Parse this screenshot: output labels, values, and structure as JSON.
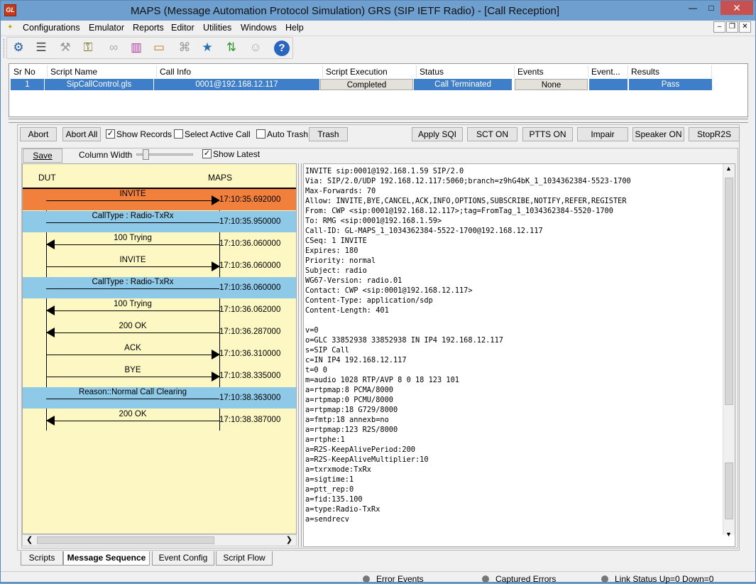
{
  "window": {
    "logo": "GL",
    "title": "MAPS (Message Automation Protocol Simulation) GRS (SIP IETF Radio) - [Call Reception]"
  },
  "menu": {
    "items": [
      "Configurations",
      "Emulator",
      "Reports",
      "Editor",
      "Utilities",
      "Windows",
      "Help"
    ]
  },
  "toolbar": {
    "icons": [
      "gear-icon",
      "book-icon",
      "tools-icon",
      "key-icon",
      "link-icon",
      "database-icon",
      "folder-icon",
      "scope-icon",
      "wizard-icon",
      "refresh-icon",
      "user-icon",
      "help-icon"
    ]
  },
  "grid": {
    "headers": [
      "Sr No",
      "Script Name",
      "Call Info",
      "Script Execution",
      "Status",
      "Events",
      "Event...",
      "Results"
    ],
    "row": [
      "1",
      "SipCallControl.gls",
      "0001@192.168.12.117",
      "Completed",
      "Call Terminated",
      "None",
      "",
      "Pass"
    ]
  },
  "controls": {
    "abort": "Abort",
    "abort_all": "Abort All",
    "show_records": "Show Records",
    "select_active_call": "Select Active Call",
    "auto_trash": "Auto Trash",
    "trash": "Trash",
    "apply_sqi": "Apply SQI",
    "sct_on": "SCT ON",
    "ptts_on": "PTTS ON",
    "impair": "Impair",
    "speaker_on": "Speaker ON",
    "stop_r2s": "StopR2S"
  },
  "seq_toolbar": {
    "save": "Save",
    "column_width": "Column Width",
    "show_latest": "Show Latest"
  },
  "sequence": {
    "left_endpoint": "DUT",
    "right_endpoint": "MAPS",
    "messages": [
      {
        "label": "INVITE",
        "time": "17:10:35.692000"
      },
      {
        "label": "CallType : Radio-TxRx",
        "time": "17:10:35.950000"
      },
      {
        "label": "100  Trying",
        "time": "17:10:36.060000"
      },
      {
        "label": "INVITE",
        "time": "17:10:36.060000"
      },
      {
        "label": "CallType : Radio-TxRx",
        "time": "17:10:36.060000"
      },
      {
        "label": "100  Trying",
        "time": "17:10:36.062000"
      },
      {
        "label": "200  OK",
        "time": "17:10:36.287000"
      },
      {
        "label": "ACK",
        "time": "17:10:36.310000"
      },
      {
        "label": "BYE",
        "time": "17:10:38.335000"
      },
      {
        "label": "Reason::Normal Call Clearing",
        "time": "17:10:38.363000"
      },
      {
        "label": "200  OK",
        "time": "17:10:38.387000"
      }
    ]
  },
  "details": {
    "lines": [
      "INVITE sip:0001@192.168.1.59 SIP/2.0",
      "Via: SIP/2.0/UDP 192.168.12.117:5060;branch=z9hG4bK_1_1034362384-5523-1700",
      "Max-Forwards: 70",
      "Allow: INVITE,BYE,CANCEL,ACK,INFO,OPTIONS,SUBSCRIBE,NOTIFY,REFER,REGISTER",
      "From: CWP <sip:0001@192.168.12.117>;tag=FromTag_1_1034362384-5520-1700",
      "To: RMG <sip:0001@192.168.1.59>",
      "Call-ID: GL-MAPS_1_1034362384-5522-1700@192.168.12.117",
      "CSeq: 1 INVITE",
      "Expires: 180",
      "Priority: normal",
      "Subject: radio",
      "WG67-Version: radio.01",
      "Contact: CWP <sip:0001@192.168.12.117>",
      "Content-Type: application/sdp",
      "Content-Length: 401",
      "",
      "v=0",
      "o=GLC 33852938 33852938 IN IP4 192.168.12.117",
      "s=SIP Call",
      "c=IN IP4 192.168.12.117",
      "t=0 0",
      "m=audio 1028 RTP/AVP 8 0 18 123 101",
      "a=rtpmap:8 PCMA/8000",
      "a=rtpmap:0 PCMU/8000",
      "a=rtpmap:18 G729/8000",
      "a=fmtp:18 annexb=no",
      "a=rtpmap:123 R2S/8000",
      "a=rtphe:1",
      "a=R2S-KeepAlivePeriod:200",
      "a=R2S-KeepAliveMultiplier:10",
      "a=txrxmode:TxRx",
      "a=sigtime:1",
      "a=ptt_rep:0",
      "a=fid:135.100",
      "a=type:Radio-TxRx",
      "a=sendrecv"
    ]
  },
  "tabs": [
    "Scripts",
    "Message Sequence",
    "Event Config",
    "Script Flow"
  ],
  "statusbar": {
    "error_events": "Error Events",
    "captured_errors": "Captured Errors",
    "link_status": "Link Status Up=0 Down=0"
  },
  "colors": {
    "selected_row": "#3f7ec8",
    "invite_band": "#f0803c",
    "info_band": "#8fc9e8",
    "sequence_bg": "#fdf7c3",
    "title_bar": "#6e9fcf",
    "close_button": "#c75050"
  }
}
